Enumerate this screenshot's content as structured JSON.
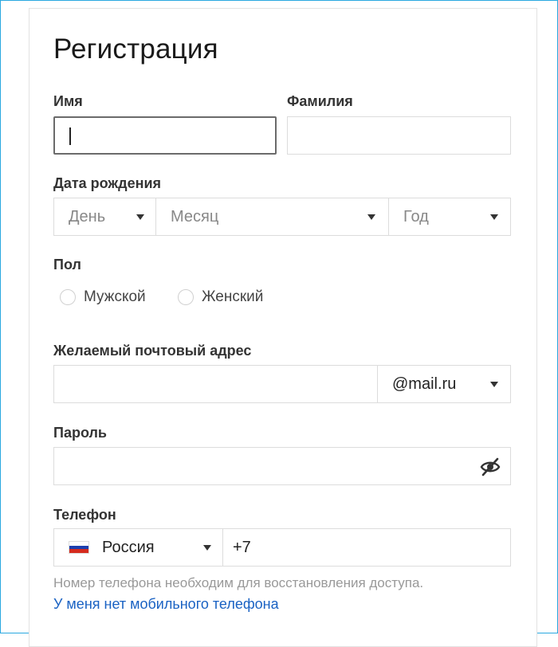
{
  "title": "Регистрация",
  "fields": {
    "first_name": {
      "label": "Имя",
      "value": ""
    },
    "last_name": {
      "label": "Фамилия",
      "value": ""
    },
    "birth_date": {
      "label": "Дата рождения",
      "day": "День",
      "month": "Месяц",
      "year": "Год"
    },
    "gender": {
      "label": "Пол",
      "options": [
        "Мужской",
        "Женский"
      ]
    },
    "email": {
      "label": "Желаемый почтовый адрес",
      "value": "",
      "domain": "@mail.ru"
    },
    "password": {
      "label": "Пароль",
      "value": ""
    },
    "phone": {
      "label": "Телефон",
      "country": "Россия",
      "prefix": "+7",
      "hint": "Номер телефона необходим для восстановления доступа.",
      "no_phone_link": "У меня нет мобильного телефона"
    }
  },
  "icons": {
    "dropdown": "chevron-down-icon",
    "password_toggle": "eye-slash-icon",
    "flag": "russia-flag-icon"
  },
  "colors": {
    "frame_border": "#2aa8e0",
    "link": "#1a62c3",
    "flag_white": "#ffffff",
    "flag_blue": "#1c3fae",
    "flag_red": "#d52b1e"
  }
}
